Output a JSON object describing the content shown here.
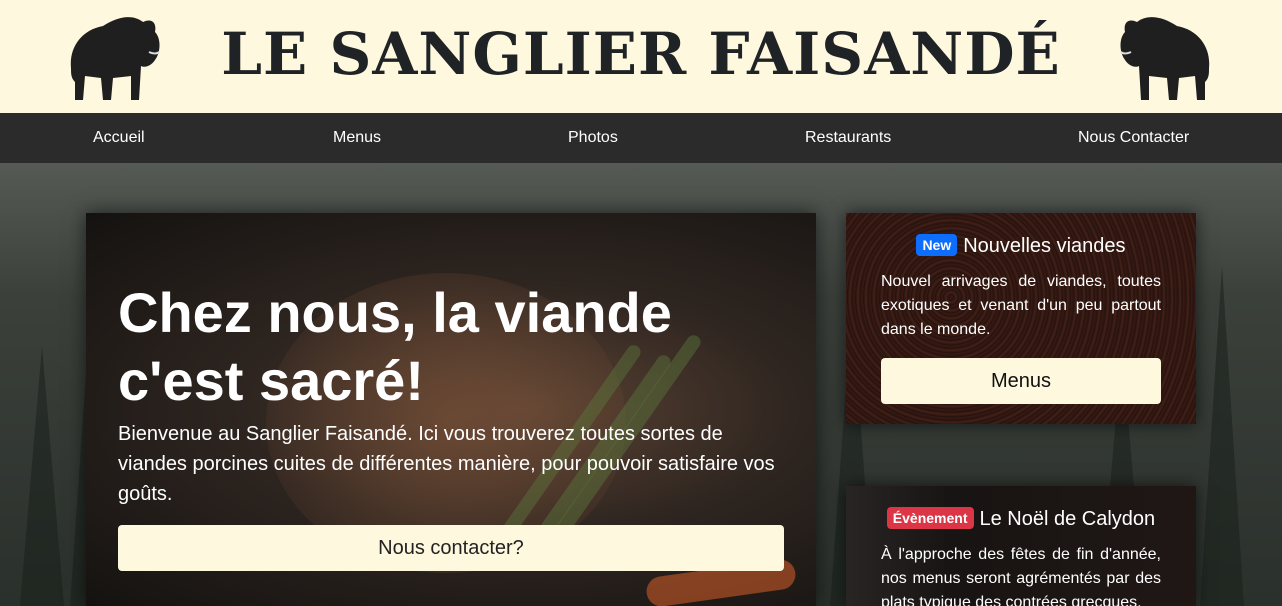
{
  "header": {
    "title": "LE SANGLIER FAISANDÉ",
    "logo_icon": "boar-icon",
    "background": "#fef8df"
  },
  "nav": {
    "items": [
      {
        "label": "Accueil"
      },
      {
        "label": "Menus"
      },
      {
        "label": "Photos"
      },
      {
        "label": "Restaurants"
      },
      {
        "label": "Nous Contacter"
      }
    ],
    "background": "#2b2b2b"
  },
  "hero": {
    "title": "Chez nous, la viande c'est sacré!",
    "text": "Bienvenue au Sanglier Faisandé. Ici vous trouverez toutes sortes de viandes porcines cuites de différentes manière, pour pouvoir satisfaire vos goûts.",
    "button": "Nous contacter?"
  },
  "cards": [
    {
      "badge": "New",
      "badge_color": "#0d6efd",
      "title": "Nouvelles viandes",
      "text": "Nouvel arrivages de viandes, toutes exotiques et venant d'un peu partout dans le monde.",
      "button": "Menus"
    },
    {
      "badge": "Évènement",
      "badge_color": "#dc3545",
      "title": "Le Noël de Calydon",
      "text": "À l'approche des fêtes de fin d'année, nos menus seront agrémentés par des plats typique des contrées grecques."
    }
  ],
  "accent": "#fef8df"
}
